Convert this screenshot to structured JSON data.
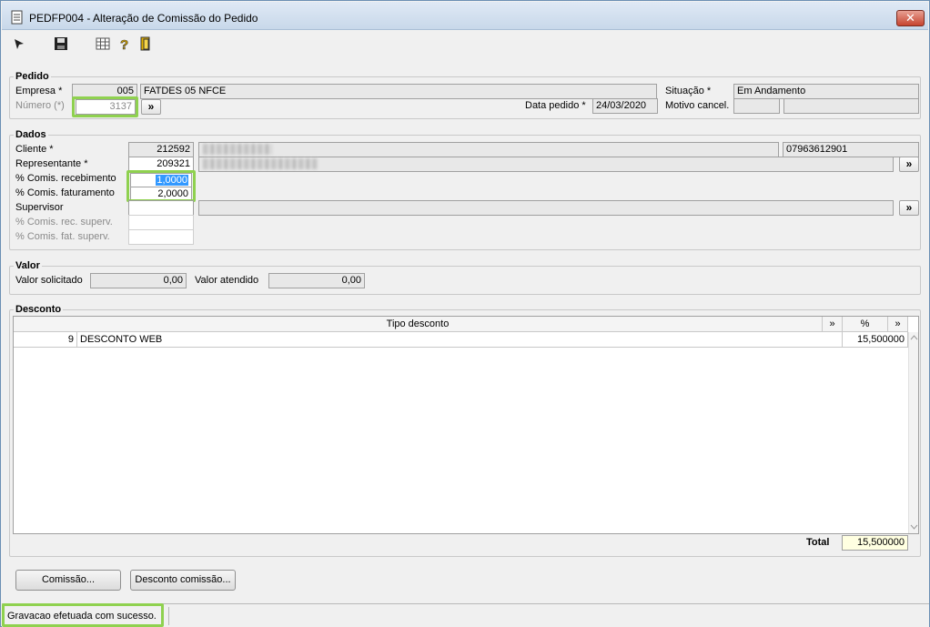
{
  "window": {
    "title": "PEDFP004 - Alteração de Comissão do Pedido",
    "close_label": "✕"
  },
  "toolbar": {
    "icons": [
      "cursor-icon",
      "save-icon",
      "calculator-icon",
      "help-icon",
      "exit-icon"
    ]
  },
  "pedido": {
    "legend": "Pedido",
    "empresa_label": "Empresa *",
    "empresa_code": "005",
    "empresa_name": "FATDES 05 NFCE",
    "numero_label": "Número (*)",
    "numero_value": "3137",
    "more_label": "»",
    "data_label": "Data pedido *",
    "data_value": "24/03/2020",
    "situacao_label": "Situação *",
    "situacao_value": "Em Andamento",
    "motivo_label": "Motivo cancel."
  },
  "dados": {
    "legend": "Dados",
    "cliente_label": "Cliente *",
    "cliente_code": "212592",
    "cliente_doc": "07963612901",
    "representante_label": "Representante *",
    "representante_code": "209321",
    "comis_receb_label": "% Comis. recebimento",
    "comis_receb_value": "1,0000",
    "comis_fat_label": "% Comis. faturamento",
    "comis_fat_value": "2,0000",
    "supervisor_label": "Supervisor",
    "comis_rec_superv_label": "% Comis. rec. superv.",
    "comis_fat_superv_label": "% Comis. fat. superv.",
    "more_label": "»"
  },
  "valor": {
    "legend": "Valor",
    "solicitado_label": "Valor solicitado",
    "solicitado_value": "0,00",
    "atendido_label": "Valor atendido",
    "atendido_value": "0,00"
  },
  "desconto": {
    "legend": "Desconto",
    "col_tipo": "Tipo desconto",
    "col_pct": "%",
    "more_label": "»",
    "rows": [
      {
        "code": "9",
        "description": "DESCONTO WEB",
        "pct": "15,500000"
      }
    ],
    "total_label": "Total",
    "total_value": "15,500000"
  },
  "buttons": {
    "comissao": "Comissão...",
    "desconto_comissao": "Desconto comissão..."
  },
  "status": {
    "message": "Gravacao efetuada com sucesso."
  }
}
